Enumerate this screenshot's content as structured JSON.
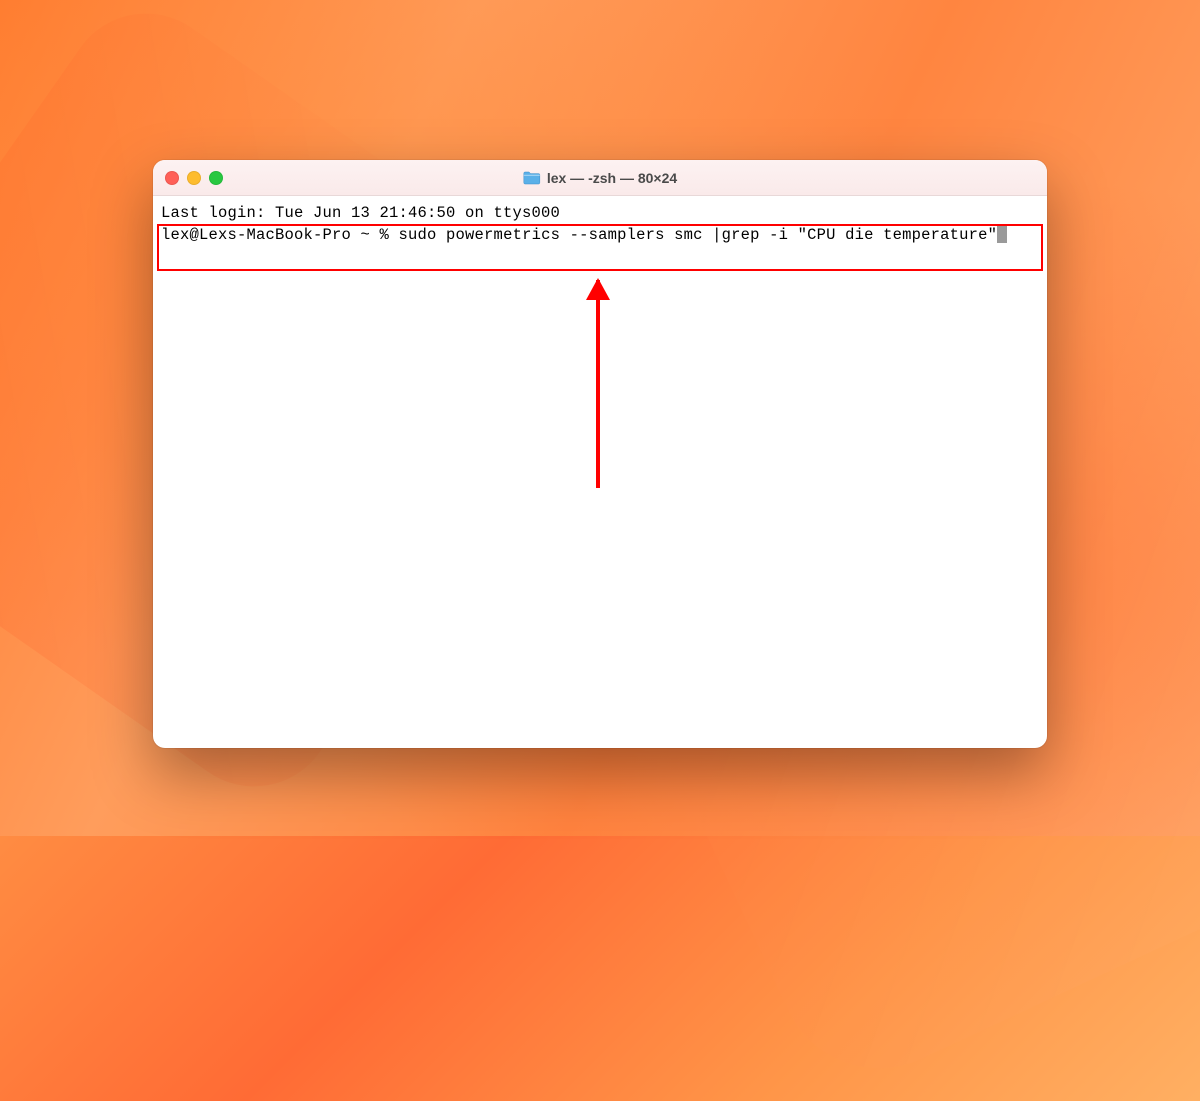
{
  "window": {
    "title": "lex — -zsh — 80×24"
  },
  "terminal": {
    "last_login": "Last login: Tue Jun 13 21:46:50 on ttys000",
    "prompt": "lex@Lexs-MacBook-Pro ~ % ",
    "command": "sudo powermetrics --samplers smc |grep -i \"CPU die temperature\""
  },
  "annotation": {
    "highlight_color": "#ff0000"
  }
}
